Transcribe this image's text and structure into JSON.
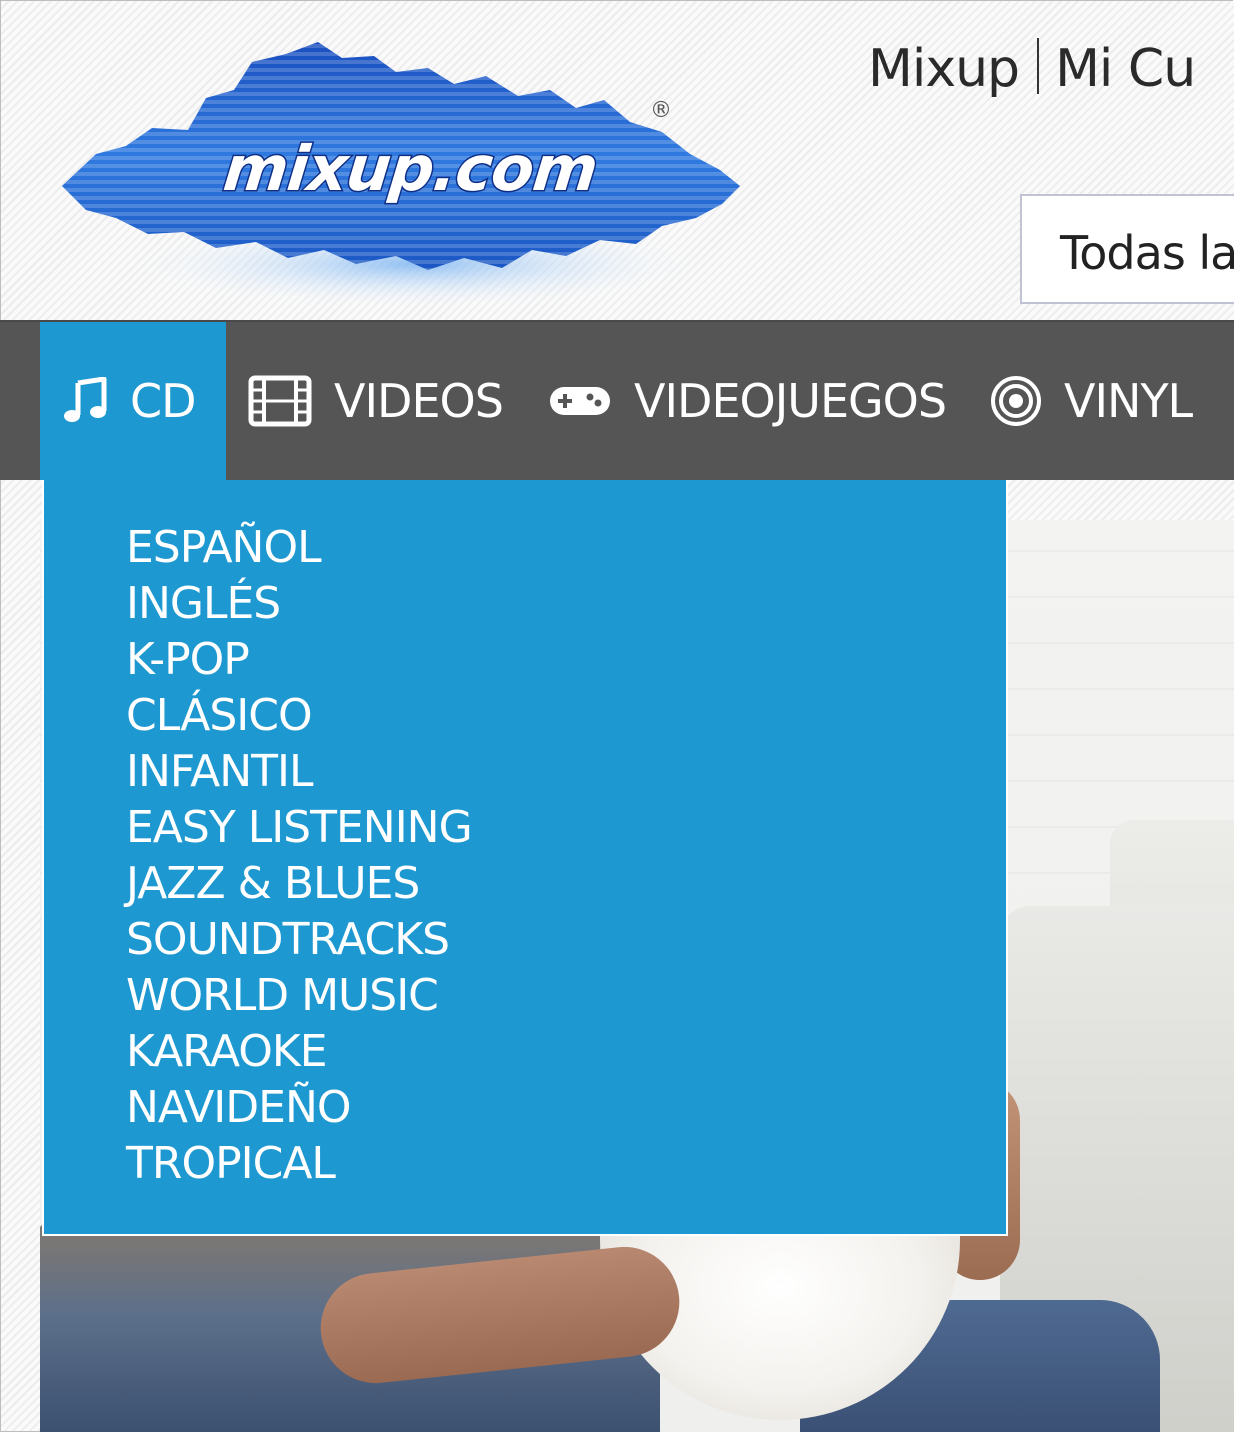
{
  "logo": {
    "text": "mixup.com",
    "registered": "®"
  },
  "top_links": {
    "mixup": "Mixup",
    "account": "Mi Cu"
  },
  "search": {
    "category_select": "Todas la"
  },
  "nav": {
    "items": [
      {
        "label": "CD",
        "icon": "music-note-icon"
      },
      {
        "label": "VIDEOS",
        "icon": "film-icon"
      },
      {
        "label": "VIDEOJUEGOS",
        "icon": "gamepad-icon"
      },
      {
        "label": "VINYL",
        "icon": "vinyl-record-icon"
      }
    ],
    "active": "CD"
  },
  "dropdown": {
    "items": [
      "ESPAÑOL",
      "INGLÉS",
      "K-POP",
      "CLÁSICO",
      "INFANTIL",
      "EASY LISTENING",
      "JAZZ & BLUES",
      "SOUNDTRACKS",
      "WORLD MUSIC",
      "KARAOKE",
      "NAVIDEÑO",
      "TROPICAL"
    ]
  },
  "colors": {
    "nav_background": "#555555",
    "accent_blue": "#1e98d1",
    "text_white": "#ffffff"
  }
}
